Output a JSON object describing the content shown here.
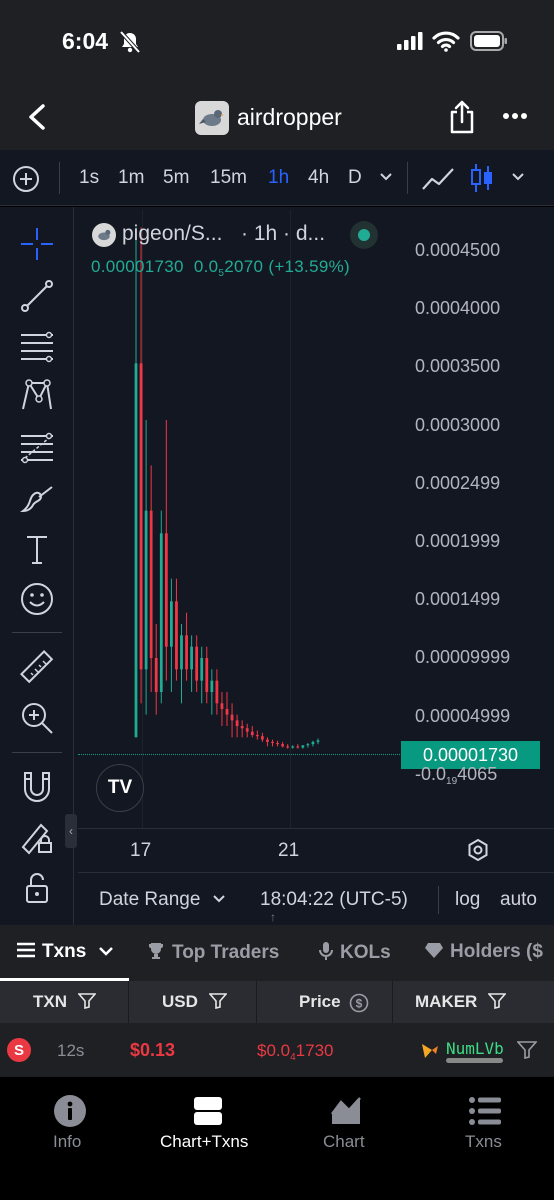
{
  "status": {
    "time": "6:04"
  },
  "header": {
    "title": "airdropper"
  },
  "toolbar": {
    "timeframes": [
      "1s",
      "1m",
      "5m",
      "15m",
      "1h",
      "4h",
      "D"
    ],
    "active_timeframe": "1h"
  },
  "chart": {
    "symbol": "pigeon/S...",
    "interval": "· 1h · d...",
    "ohlc_close": "0.00001730",
    "ohlc_change_main": "0.0",
    "ohlc_change_sub": "5",
    "ohlc_change_tail": "2070",
    "ohlc_change_pct": "(+13.59%)",
    "current_price_label": "0.00001730",
    "low_label_main": "-0.0",
    "low_label_sub": "19",
    "low_label_tail": "4065",
    "y_ticks": [
      "0.0004500",
      "0.0004000",
      "0.0003500",
      "0.0003000",
      "0.0002499",
      "0.0001999",
      "0.0001499",
      "0.00009999",
      "0.00004999"
    ],
    "x_ticks": [
      "17",
      "21"
    ],
    "date_range": "Date Range",
    "clock": "18:04:22 (UTC-5)",
    "log": "log",
    "auto": "auto",
    "logo": "TV"
  },
  "chart_data": {
    "type": "candlestick",
    "title": "pigeon/S... · 1h",
    "ylim": [
      -1.5e-05,
      0.00047
    ],
    "x_ticks": [
      "17",
      "21"
    ],
    "y_ticks": [
      0.00045,
      0.0004,
      0.00035,
      0.0003,
      0.0002499,
      0.0001999,
      0.0001499,
      9.999e-05,
      4.999e-05
    ],
    "last_price": 1.73e-05,
    "up_color": "#22ab94",
    "down_color": "#f23645",
    "candles": [
      {
        "o": 2e-05,
        "h": 0.00047,
        "l": 2e-05,
        "c": 0.00035
      },
      {
        "o": 0.00035,
        "h": 0.00047,
        "l": 5e-05,
        "c": 8e-05
      },
      {
        "o": 8e-05,
        "h": 0.0003,
        "l": 4e-05,
        "c": 0.00022
      },
      {
        "o": 0.00022,
        "h": 0.00026,
        "l": 6e-05,
        "c": 9e-05
      },
      {
        "o": 9e-05,
        "h": 0.00012,
        "l": 4e-05,
        "c": 6e-05
      },
      {
        "o": 6e-05,
        "h": 0.00022,
        "l": 5e-05,
        "c": 0.0002
      },
      {
        "o": 0.0002,
        "h": 0.0003,
        "l": 7e-05,
        "c": 0.0001
      },
      {
        "o": 0.0001,
        "h": 0.00016,
        "l": 6e-05,
        "c": 0.00014
      },
      {
        "o": 0.00014,
        "h": 0.00016,
        "l": 7e-05,
        "c": 8e-05
      },
      {
        "o": 8e-05,
        "h": 0.00012,
        "l": 5e-05,
        "c": 0.00011
      },
      {
        "o": 0.00011,
        "h": 0.00013,
        "l": 7e-05,
        "c": 8e-05
      },
      {
        "o": 8e-05,
        "h": 0.00011,
        "l": 6e-05,
        "c": 0.0001
      },
      {
        "o": 0.0001,
        "h": 0.00011,
        "l": 6e-05,
        "c": 7e-05
      },
      {
        "o": 7e-05,
        "h": 0.0001,
        "l": 5e-05,
        "c": 9e-05
      },
      {
        "o": 9e-05,
        "h": 0.0001,
        "l": 5e-05,
        "c": 6e-05
      },
      {
        "o": 6e-05,
        "h": 8e-05,
        "l": 4e-05,
        "c": 7e-05
      },
      {
        "o": 7e-05,
        "h": 8e-05,
        "l": 4e-05,
        "c": 5e-05
      },
      {
        "o": 5e-05,
        "h": 6e-05,
        "l": 3e-05,
        "c": 4.5e-05
      },
      {
        "o": 4.5e-05,
        "h": 6e-05,
        "l": 3e-05,
        "c": 4e-05
      },
      {
        "o": 4e-05,
        "h": 5e-05,
        "l": 2e-05,
        "c": 3.5e-05
      },
      {
        "o": 3.5e-05,
        "h": 4e-05,
        "l": 2e-05,
        "c": 3e-05
      },
      {
        "o": 3e-05,
        "h": 3.5e-05,
        "l": 2e-05,
        "c": 2.8e-05
      },
      {
        "o": 2.8e-05,
        "h": 3.2e-05,
        "l": 2e-05,
        "c": 2.5e-05
      },
      {
        "o": 2.5e-05,
        "h": 3e-05,
        "l": 2e-05,
        "c": 2.2e-05
      },
      {
        "o": 2.2e-05,
        "h": 2.6e-05,
        "l": 1.8e-05,
        "c": 2.1e-05
      },
      {
        "o": 2.1e-05,
        "h": 2.4e-05,
        "l": 1.6e-05,
        "c": 1.8e-05
      },
      {
        "o": 1.8e-05,
        "h": 2e-05,
        "l": 1.2e-05,
        "c": 1.6e-05
      },
      {
        "o": 1.6e-05,
        "h": 1.8e-05,
        "l": 1.2e-05,
        "c": 1.5e-05
      },
      {
        "o": 1.5e-05,
        "h": 1.7e-05,
        "l": 1.2e-05,
        "c": 1.4e-05
      },
      {
        "o": 1.4e-05,
        "h": 1.6e-05,
        "l": 1.1e-05,
        "c": 1.2e-05
      },
      {
        "o": 1.2e-05,
        "h": 1.4e-05,
        "l": 1e-05,
        "c": 1.1e-05
      },
      {
        "o": 1.1e-05,
        "h": 1.3e-05,
        "l": 1e-05,
        "c": 1.2e-05
      },
      {
        "o": 1.2e-05,
        "h": 1.4e-05,
        "l": 1e-05,
        "c": 1.1e-05
      },
      {
        "o": 1.1e-05,
        "h": 1.3e-05,
        "l": 1e-05,
        "c": 1.3e-05
      },
      {
        "o": 1.3e-05,
        "h": 1.5e-05,
        "l": 1.1e-05,
        "c": 1.4e-05
      },
      {
        "o": 1.4e-05,
        "h": 1.7e-05,
        "l": 1.2e-05,
        "c": 1.6e-05
      },
      {
        "o": 1.6e-05,
        "h": 1.9e-05,
        "l": 1.4e-05,
        "c": 1.73e-05
      }
    ]
  },
  "tabs": [
    {
      "label": "Txns"
    },
    {
      "label": "Top Traders"
    },
    {
      "label": "KOLs"
    },
    {
      "label": "Holders ($"
    }
  ],
  "table": {
    "headers": [
      "TXN",
      "USD",
      "Price",
      "MAKER"
    ],
    "row": {
      "type": "S",
      "age": "12s",
      "usd": "$0.13",
      "price_main": "$0.0",
      "price_sub": "4",
      "price_tail": "1730",
      "maker": "NumLVb"
    }
  },
  "nav": [
    {
      "label": "Info"
    },
    {
      "label": "Chart+Txns"
    },
    {
      "label": "Chart"
    },
    {
      "label": "Txns"
    }
  ],
  "colors": {
    "accent_blue": "#2962ff",
    "up_green": "#22ab94",
    "down_red": "#f23645",
    "price_tag": "#089981",
    "background": "#131722"
  }
}
